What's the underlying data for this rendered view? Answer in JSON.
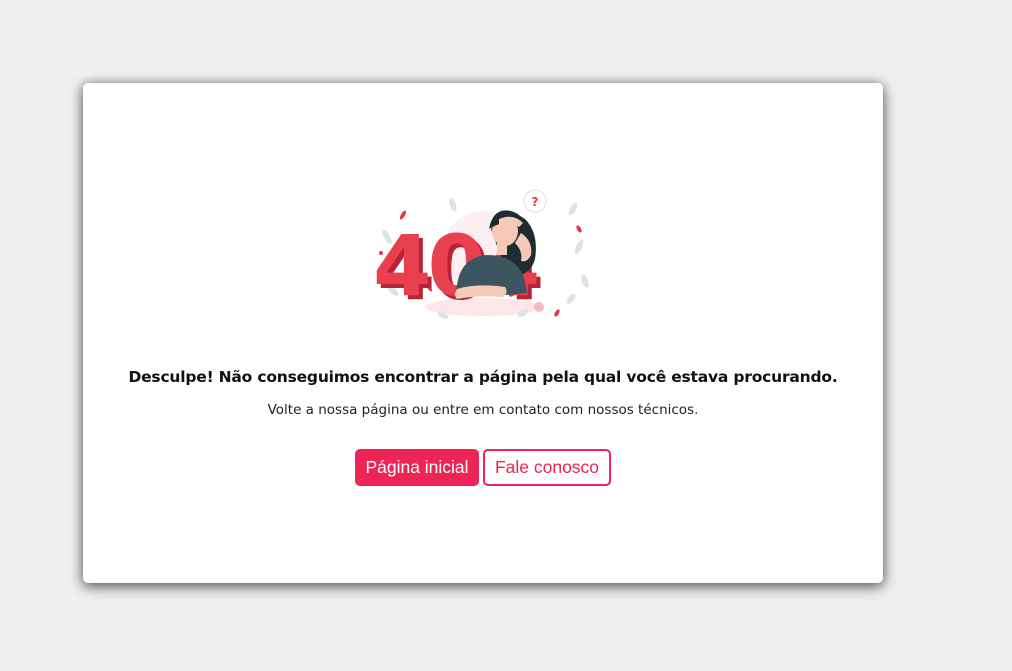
{
  "illustration": {
    "icon": "404-illustration",
    "digits": "404",
    "question_mark": "?",
    "accent_color": "#e5354d"
  },
  "error": {
    "heading": "Desculpe! Não conseguimos encontrar a página pela qual você estava procurando.",
    "message": "Volte a nossa página ou entre em contato com nossos técnicos."
  },
  "actions": {
    "home_label": "Página inicial",
    "contact_label": "Fale conosco"
  },
  "colors": {
    "background": "#efefef",
    "card": "#ffffff",
    "brand": "#ee2456"
  }
}
